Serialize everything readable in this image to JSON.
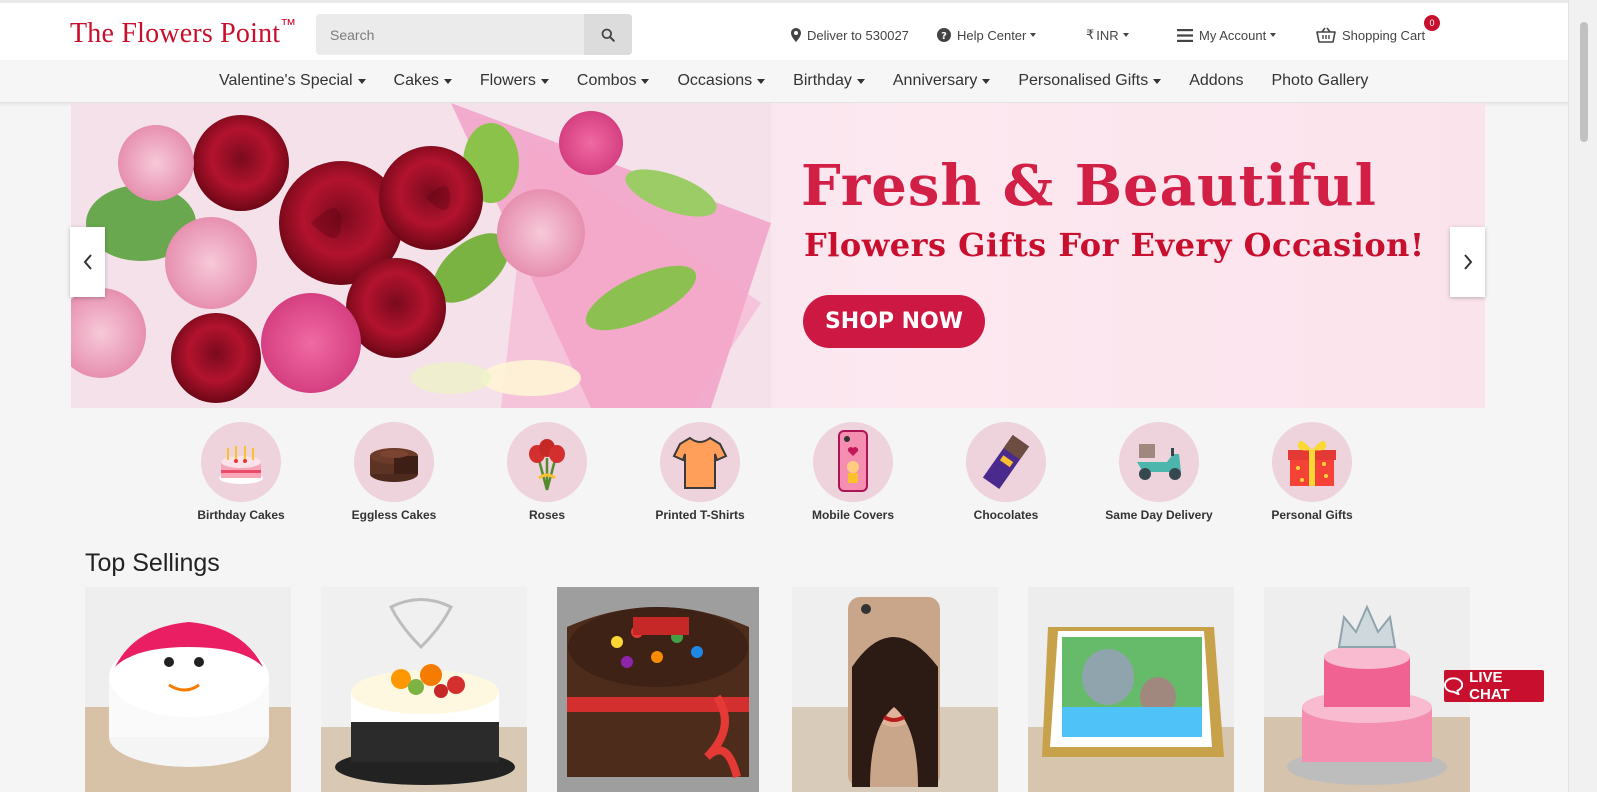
{
  "header": {
    "logo_text": "The Flowers Point",
    "logo_tm": "™",
    "search_placeholder": "Search",
    "deliver_label": "Deliver to 530027",
    "help_label": "Help Center",
    "currency_symbol": "₹",
    "currency_label": "INR",
    "account_label": "My Account",
    "cart_label": "Shopping Cart",
    "cart_count": "0"
  },
  "nav": {
    "items": [
      {
        "label": "Valentine's Special",
        "dropdown": true
      },
      {
        "label": "Cakes",
        "dropdown": true
      },
      {
        "label": "Flowers",
        "dropdown": true
      },
      {
        "label": "Combos",
        "dropdown": true
      },
      {
        "label": "Occasions",
        "dropdown": true
      },
      {
        "label": "Birthday",
        "dropdown": true
      },
      {
        "label": "Anniversary",
        "dropdown": true
      },
      {
        "label": "Personalised Gifts",
        "dropdown": true
      },
      {
        "label": "Addons",
        "dropdown": false
      },
      {
        "label": "Photo Gallery",
        "dropdown": false
      }
    ]
  },
  "banner": {
    "headline": "Fresh & Beautiful",
    "subheadline": "Flowers Gifts For Every Occasion!",
    "cta": "SHOP NOW"
  },
  "categories": [
    {
      "label": "Birthday Cakes",
      "icon": "birthday-cake-icon"
    },
    {
      "label": "Eggless Cakes",
      "icon": "chocolate-cake-icon"
    },
    {
      "label": "Roses",
      "icon": "roses-icon"
    },
    {
      "label": "Printed T-Shirts",
      "icon": "tshirt-icon"
    },
    {
      "label": "Mobile Covers",
      "icon": "mobile-cover-icon"
    },
    {
      "label": "Chocolates",
      "icon": "chocolate-bar-icon"
    },
    {
      "label": "Same Day Delivery",
      "icon": "delivery-scooter-icon"
    },
    {
      "label": "Personal Gifts",
      "icon": "gift-box-icon"
    }
  ],
  "top_sellings": {
    "title": "Top Sellings"
  },
  "live_chat": "LIVE CHAT",
  "colors": {
    "brand": "#c8102e",
    "banner_bg": "#fbe3ec",
    "category_circle": "#eed2dc"
  }
}
